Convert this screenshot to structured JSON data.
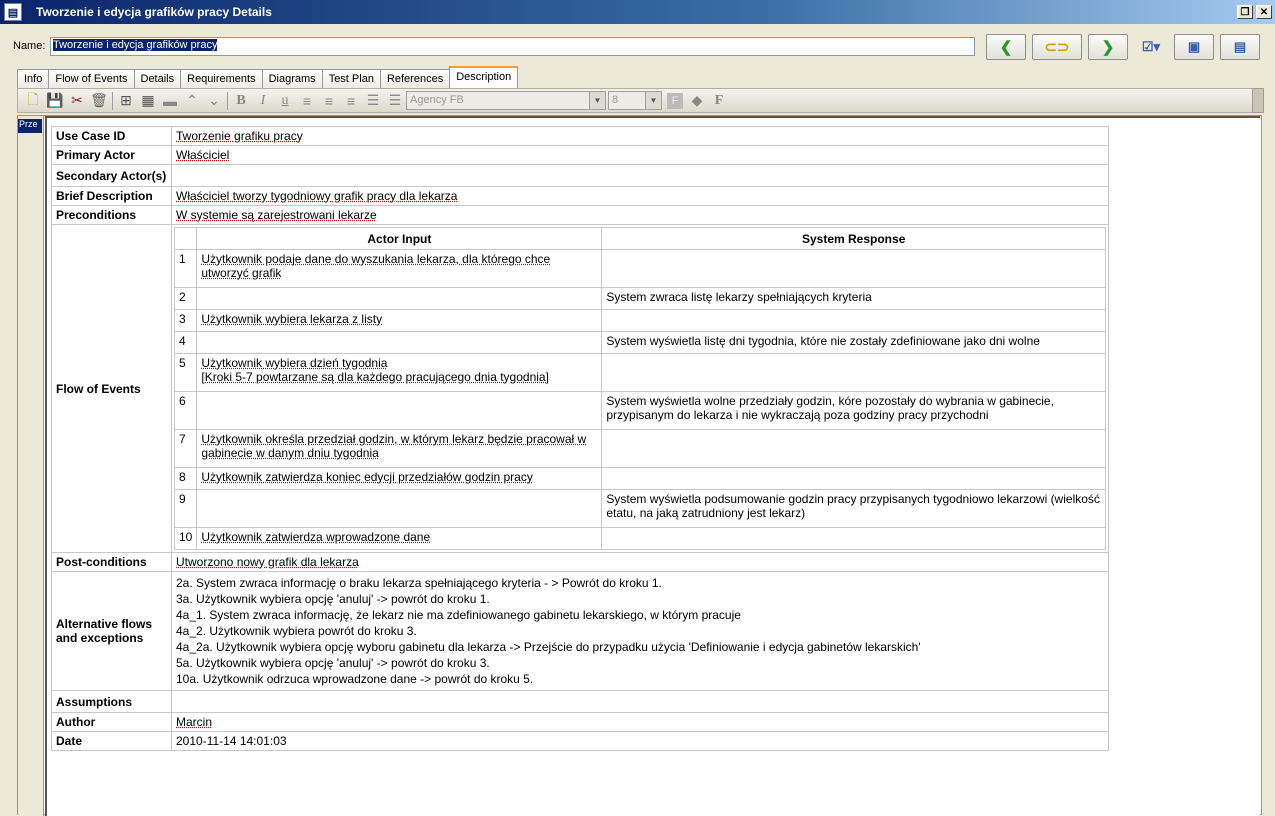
{
  "window": {
    "title": "Tworzenie i edycja grafików pracy Details"
  },
  "name_field": {
    "label": "Name:",
    "value": "Tworzenie i edycja grafików pracy"
  },
  "tabs": [
    "Info",
    "Flow of Events",
    "Details",
    "Requirements",
    "Diagrams",
    "Test Plan",
    "References",
    "Description"
  ],
  "active_tab": "Description",
  "format_toolbar": {
    "font": "Agency FB",
    "size": "8",
    "bold": "B",
    "italic": "I",
    "underline": "u",
    "font_btn": "F"
  },
  "left_panel_label": "Prze",
  "use_case": {
    "use_case_id_label": "Use Case ID",
    "use_case_id": "Tworzenie grafiku pracy",
    "primary_actor_label": "Primary Actor",
    "primary_actor": "Właściciel",
    "secondary_actor_label": "Secondary Actor(s)",
    "secondary_actor": "",
    "brief_label": "Brief Description",
    "brief": "Właściciel tworzy tygodniowy grafik pracy dla lekarza",
    "preconditions_label": "Preconditions",
    "preconditions": "W systemie są zarejestrowani lekarze",
    "flow_label": "Flow of Events",
    "flow_headers": {
      "actor": "Actor Input",
      "system": "System Response"
    },
    "flow_rows": [
      {
        "n": "1",
        "actor": "Użytkownik podaje dane do wyszukania lekarza, dla którego chce utworzyć grafik",
        "system": ""
      },
      {
        "n": "2",
        "actor": "",
        "system": "System zwraca listę lekarzy spełniających kryteria"
      },
      {
        "n": "3",
        "actor": "Użytkownik wybiera lekarza z listy",
        "system": ""
      },
      {
        "n": "4",
        "actor": "",
        "system": "System wyświetla listę dni tygodnia, które nie zostały zdefiniowane jako dni wolne"
      },
      {
        "n": "5",
        "actor": "Użytkownik wybiera dzień tygodnia",
        "actor2": "[Kroki 5-7 powtarzane są dla każdego pracującego dnia tygodnia]",
        "system": ""
      },
      {
        "n": "6",
        "actor": "",
        "system": "System wyświetla wolne przedziały godzin, kóre pozostały do wybrania w gabinecie, przypisanym do lekarza i nie wykraczają poza godziny pracy przychodni"
      },
      {
        "n": "7",
        "actor": "Użytkownik określa przedział godzin, w którym lekarz będzie pracował w gabinecie w danym dniu tygodnia",
        "system": ""
      },
      {
        "n": "8",
        "actor": "Użytkownik zatwierdza koniec edycji przedziałów godzin pracy",
        "system": ""
      },
      {
        "n": "9",
        "actor": "",
        "system": "System wyświetla podsumowanie godzin pracy przypisanych tygodniowo lekarzowi (wielkość etatu, na jaką zatrudniony jest lekarz)"
      },
      {
        "n": "10",
        "actor": "Użytkownik zatwierdza wprowadzone dane",
        "system": ""
      }
    ],
    "post_label": "Post-conditions",
    "post": "Utworzono nowy grafik dla lekarza",
    "alt_label": "Alternative flows and exceptions",
    "alt_lines": [
      "2a. System zwraca informację o braku lekarza spełniającego kryteria - > Powrót do kroku 1.",
      "3a. Użytkownik wybiera opcję 'anuluj' -> powrót do kroku 1.",
      "4a_1. System zwraca informację, że lekarz nie ma zdefiniowanego gabinetu lekarskiego, w którym pracuje",
      "4a_2. Użytkownik wybiera powrót do kroku 3.",
      "4a_2a. Użytkownik wybiera opcję wyboru gabinetu dla lekarza -> Przejście do przypadku użycia 'Definiowanie i edycja gabinetów lekarskich'",
      "5a. Użytkownik wybiera opcję 'anuluj' -> powrót do kroku 3.",
      "10a. Użytkownik odrzuca wprowadzone dane -> powrót do kroku 5."
    ],
    "assumptions_label": "Assumptions",
    "assumptions": "",
    "author_label": "Author",
    "author": "Marcin",
    "date_label": "Date",
    "date": "2010-11-14 14:01:03"
  }
}
